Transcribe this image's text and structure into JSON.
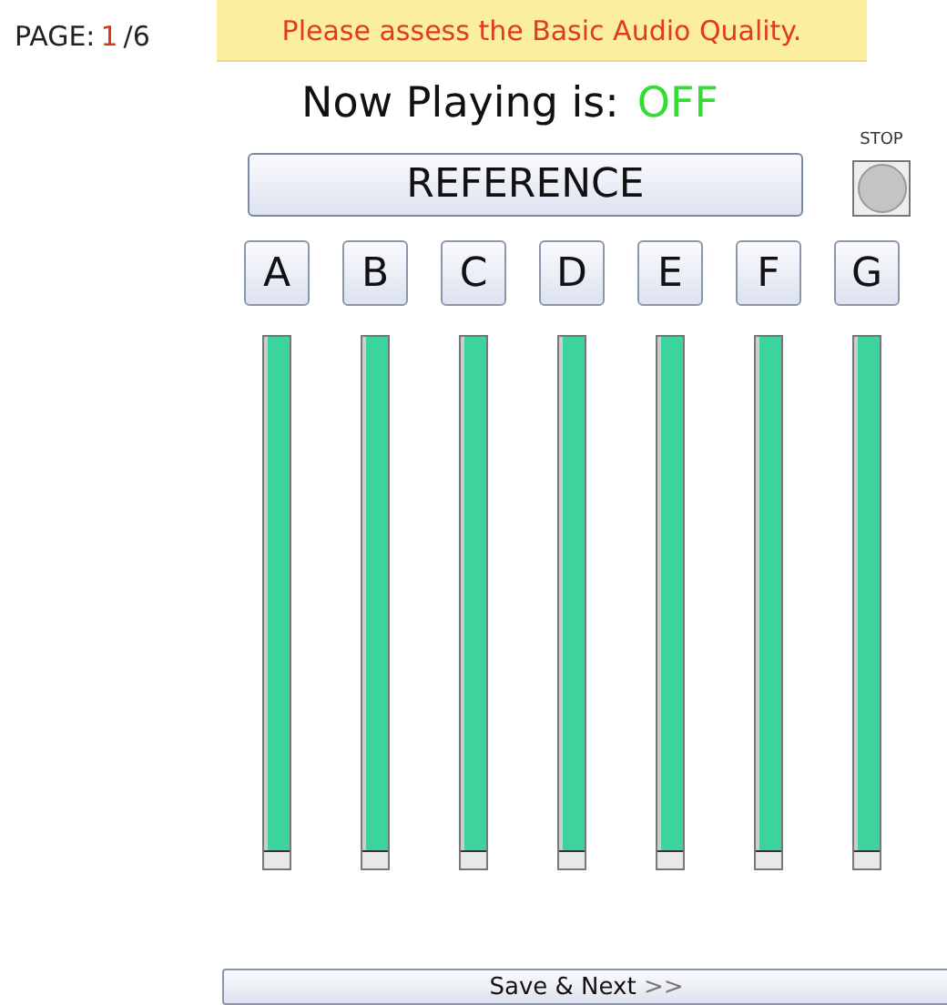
{
  "page": {
    "label": "PAGE:",
    "current": "1",
    "total": "/6"
  },
  "instruction": "Please assess the Basic Audio Quality.",
  "now_playing": {
    "label": "Now Playing is:",
    "value": "OFF"
  },
  "reference_button": "REFERENCE",
  "stop": {
    "label": "STOP"
  },
  "samples": [
    {
      "label": "A",
      "level": 0
    },
    {
      "label": "B",
      "level": 0
    },
    {
      "label": "C",
      "level": 0
    },
    {
      "label": "D",
      "level": 0
    },
    {
      "label": "E",
      "level": 0
    },
    {
      "label": "F",
      "level": 0
    },
    {
      "label": "G",
      "level": 0
    }
  ],
  "save_button": {
    "label": "Save & Next",
    "arrows": ">>"
  }
}
